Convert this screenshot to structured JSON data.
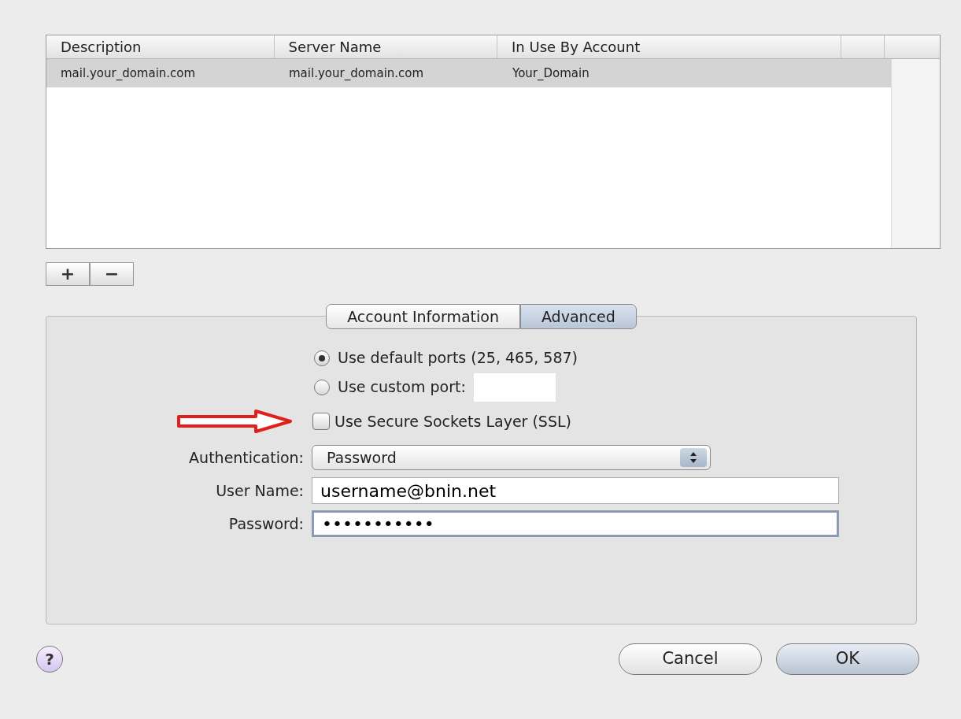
{
  "table": {
    "columns": [
      "Description",
      "Server Name",
      "In Use By Account"
    ],
    "rows": [
      {
        "cells": [
          "mail.your_domain.com",
          "mail.your_domain.com",
          "Your_Domain"
        ],
        "selected": true
      }
    ]
  },
  "list_buttons": [
    "+",
    "−"
  ],
  "tabs": [
    {
      "label": "Account Information",
      "selected": false
    },
    {
      "label": "Advanced",
      "selected": true
    }
  ],
  "ports": [
    {
      "label": "Use default ports (25, 465, 587)",
      "selected": true,
      "kind": "plain"
    },
    {
      "label": "Use custom port:",
      "selected": false,
      "kind": "field"
    }
  ],
  "ssl": {
    "label": "Use Secure Sockets Layer (SSL)",
    "checked": false
  },
  "authentication": {
    "label": "Authentication:",
    "value": "Password"
  },
  "user_name": {
    "label": "User Name:",
    "value": "username@bnin.net"
  },
  "password": {
    "label": "Password:",
    "value": "•••••••••••"
  },
  "help": "?",
  "buttons": [
    {
      "label": "Cancel",
      "default": false
    },
    {
      "label": "OK",
      "default": true
    }
  ]
}
